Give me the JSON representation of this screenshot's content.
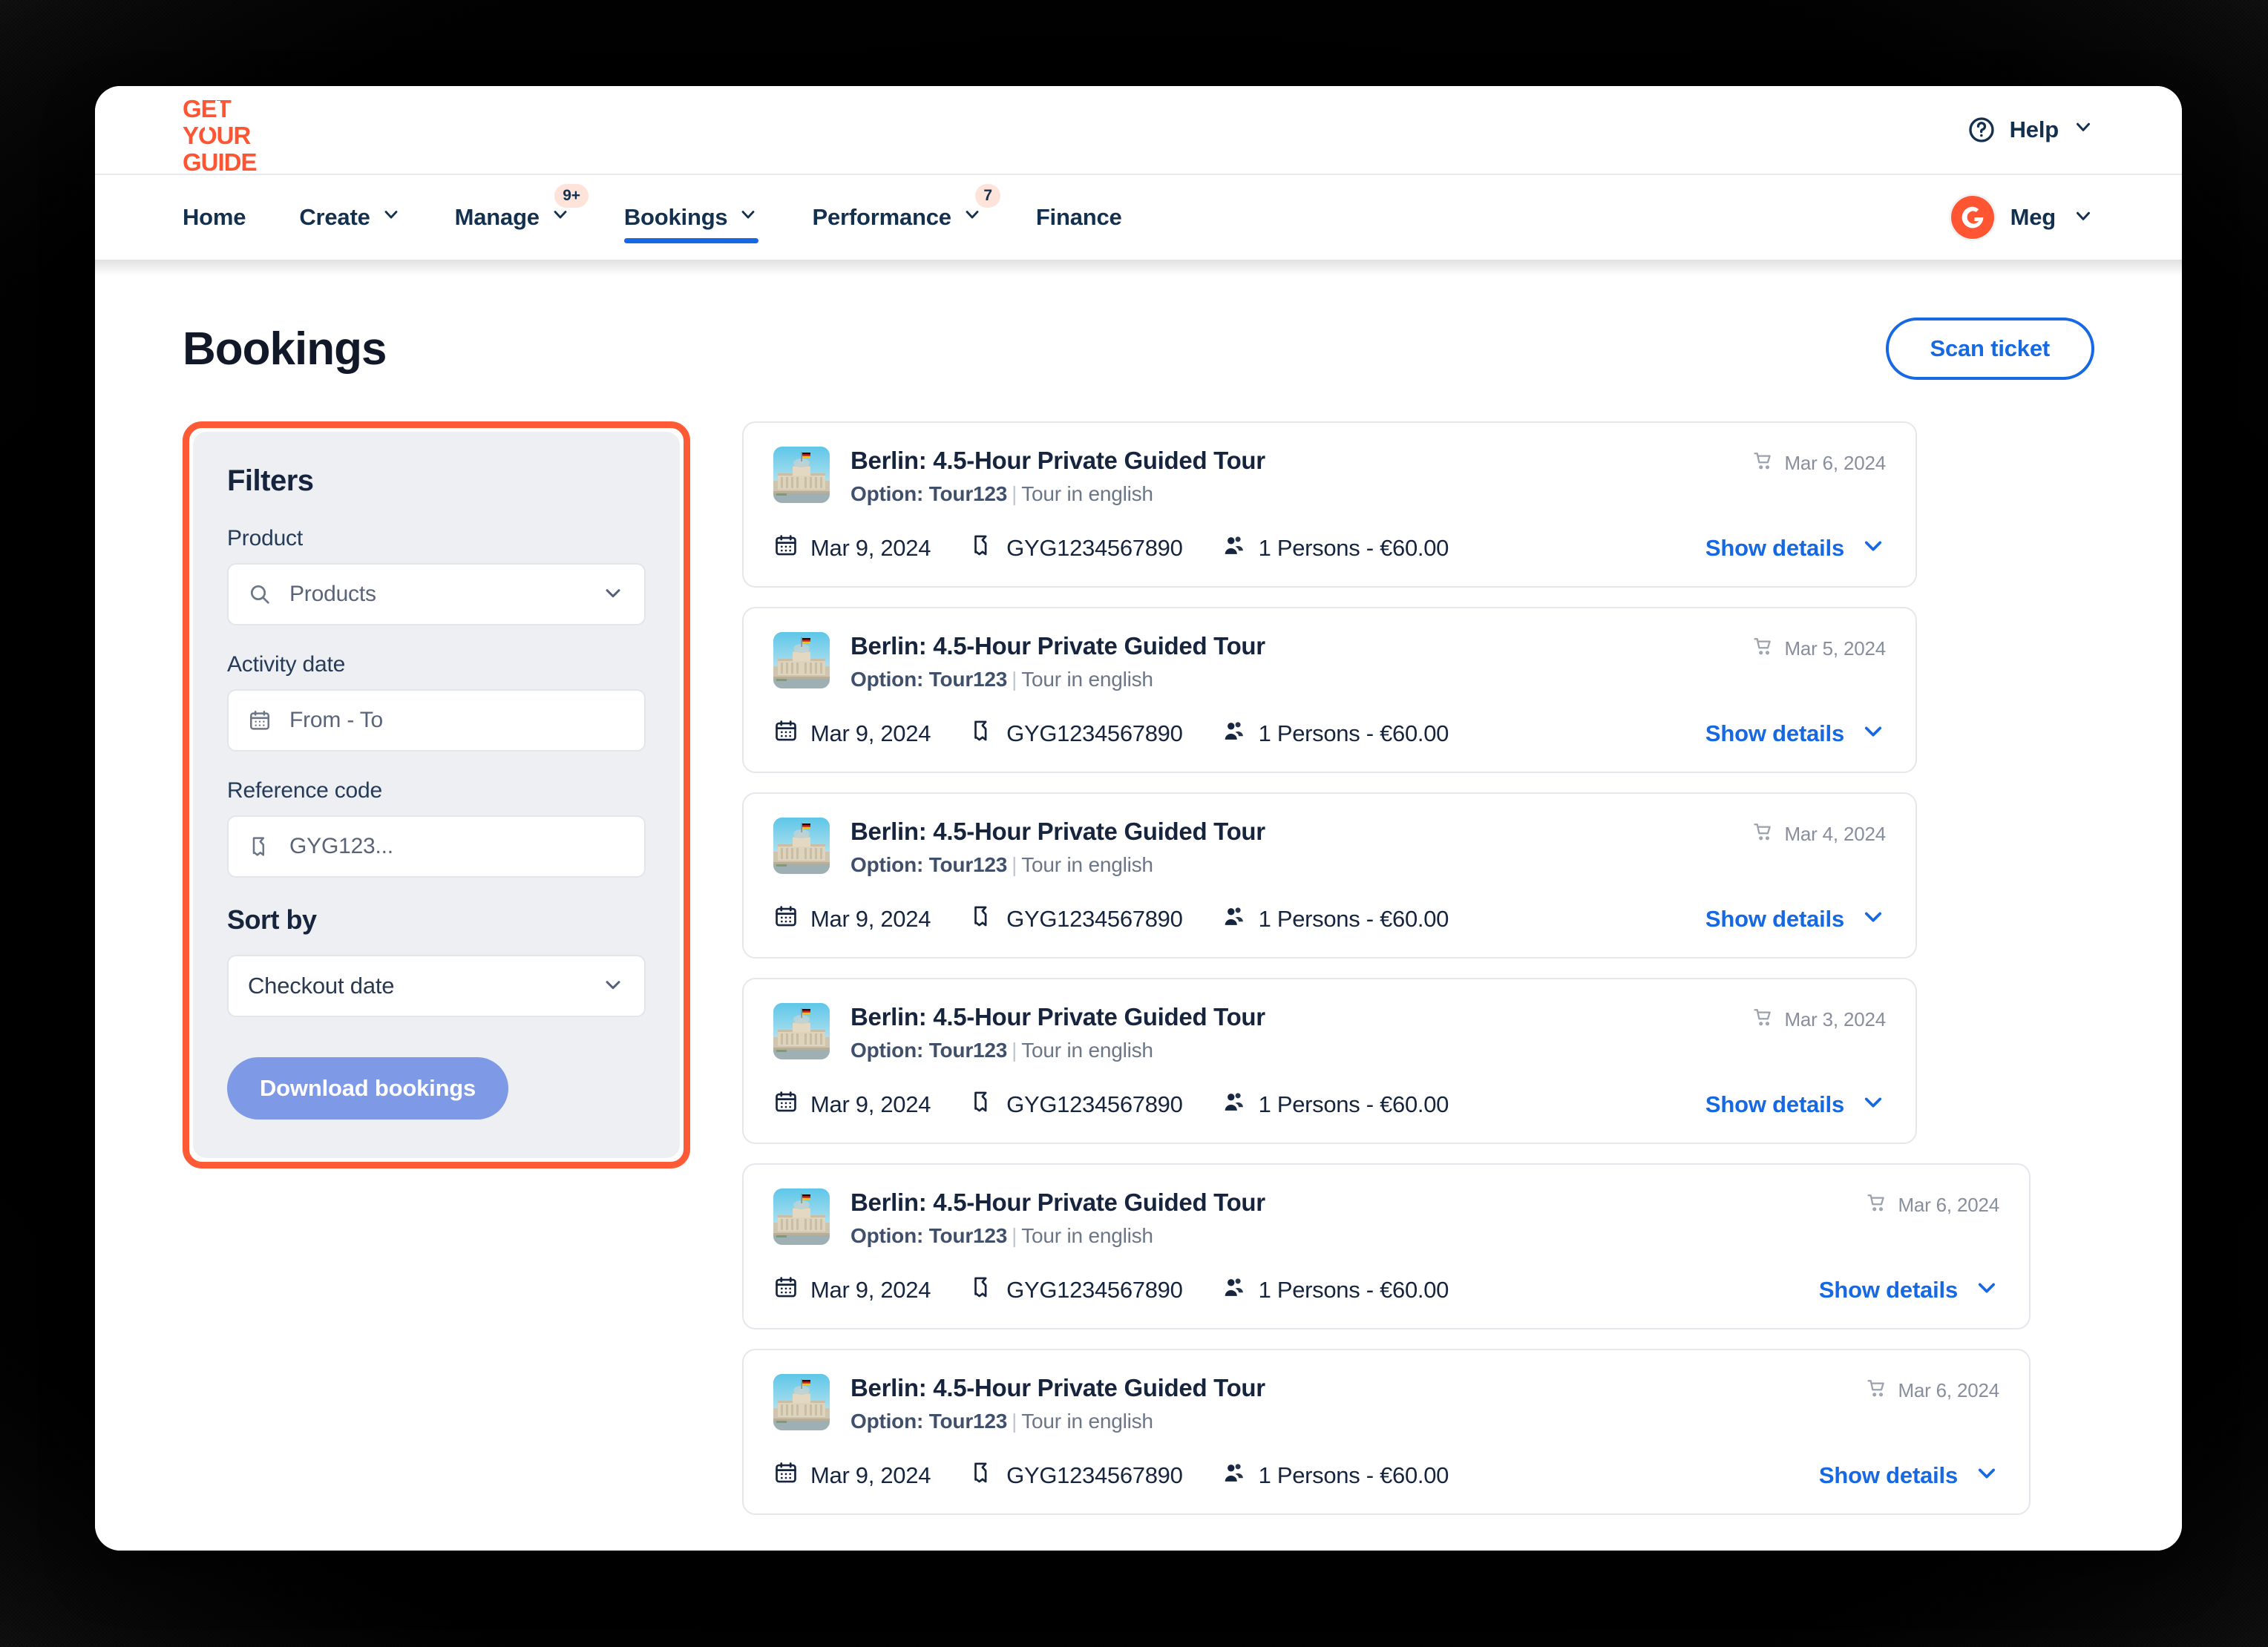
{
  "brand": {
    "logo_line1": "GET",
    "logo_line2": "YOUR",
    "logo_line3": "GUIDE",
    "logo_color": "#ff5533",
    "accent_blue": "#1668e3",
    "highlight_orange": "#ff5a36"
  },
  "header": {
    "help_label": "Help",
    "help_icon": "question-circle-icon",
    "help_chevron": "chevron-down-icon"
  },
  "nav": {
    "items": [
      {
        "label": "Home",
        "has_chevron": false,
        "badge": "",
        "active": false
      },
      {
        "label": "Create",
        "has_chevron": true,
        "badge": "",
        "active": false
      },
      {
        "label": "Manage",
        "has_chevron": true,
        "badge": "9+",
        "active": false
      },
      {
        "label": "Bookings",
        "has_chevron": true,
        "badge": "",
        "active": true
      },
      {
        "label": "Performance",
        "has_chevron": true,
        "badge": "7",
        "active": false
      },
      {
        "label": "Finance",
        "has_chevron": false,
        "badge": "",
        "active": false
      }
    ],
    "user": {
      "name": "Meg",
      "avatar_letter": "G",
      "avatar_icon": "gyg-logo-icon",
      "chevron": "chevron-down-icon"
    }
  },
  "page": {
    "title": "Bookings",
    "scan_ticket_label": "Scan ticket"
  },
  "filters": {
    "title": "Filters",
    "product_label": "Product",
    "product_placeholder": "Products",
    "product_icon": "search-icon",
    "product_chevron": "chevron-down-icon",
    "activity_date_label": "Activity date",
    "activity_date_placeholder": "From - To",
    "activity_date_icon": "calendar-icon",
    "reference_code_label": "Reference code",
    "reference_code_placeholder": "GYG123...",
    "reference_code_icon": "ticket-icon",
    "sort_by_label": "Sort by",
    "sort_by_value": "Checkout date",
    "sort_by_chevron": "chevron-down-icon",
    "download_label": "Download bookings"
  },
  "bookings": [
    {
      "title": "Berlin: 4.5-Hour Private Guided Tour",
      "option_prefix": "Option: Tour123",
      "option_suffix": "Tour in english",
      "checkout_date": "Mar 6, 2024",
      "activity_date": "Mar 9, 2024",
      "reference": "GYG1234567890",
      "participants": "1 Persons - €60.00",
      "show_details": "Show details",
      "width": "narrow"
    },
    {
      "title": "Berlin: 4.5-Hour Private Guided Tour",
      "option_prefix": "Option: Tour123",
      "option_suffix": "Tour in english",
      "checkout_date": "Mar 5, 2024",
      "activity_date": "Mar 9, 2024",
      "reference": "GYG1234567890",
      "participants": "1 Persons - €60.00",
      "show_details": "Show details",
      "width": "narrow"
    },
    {
      "title": "Berlin: 4.5-Hour Private Guided Tour",
      "option_prefix": "Option: Tour123",
      "option_suffix": "Tour in english",
      "checkout_date": "Mar 4, 2024",
      "activity_date": "Mar 9, 2024",
      "reference": "GYG1234567890",
      "participants": "1 Persons - €60.00",
      "show_details": "Show details",
      "width": "narrow"
    },
    {
      "title": "Berlin: 4.5-Hour Private Guided Tour",
      "option_prefix": "Option: Tour123",
      "option_suffix": "Tour in english",
      "checkout_date": "Mar 3, 2024",
      "activity_date": "Mar 9, 2024",
      "reference": "GYG1234567890",
      "participants": "1 Persons - €60.00",
      "show_details": "Show details",
      "width": "narrow"
    },
    {
      "title": "Berlin: 4.5-Hour Private Guided Tour",
      "option_prefix": "Option: Tour123",
      "option_suffix": "Tour in english",
      "checkout_date": "Mar 6, 2024",
      "activity_date": "Mar 9, 2024",
      "reference": "GYG1234567890",
      "participants": "1 Persons - €60.00",
      "show_details": "Show details",
      "width": "wide"
    },
    {
      "title": "Berlin: 4.5-Hour Private Guided Tour",
      "option_prefix": "Option: Tour123",
      "option_suffix": "Tour in english",
      "checkout_date": "Mar 6, 2024",
      "activity_date": "Mar 9, 2024",
      "reference": "GYG1234567890",
      "participants": "1 Persons - €60.00",
      "show_details": "Show details",
      "width": "wide"
    }
  ],
  "icons": {
    "checkout": "shopping-cart-icon",
    "activity_date": "calendar-icon",
    "reference": "ticket-icon",
    "participants": "people-icon",
    "show_details_chevron": "chevron-down-icon"
  }
}
